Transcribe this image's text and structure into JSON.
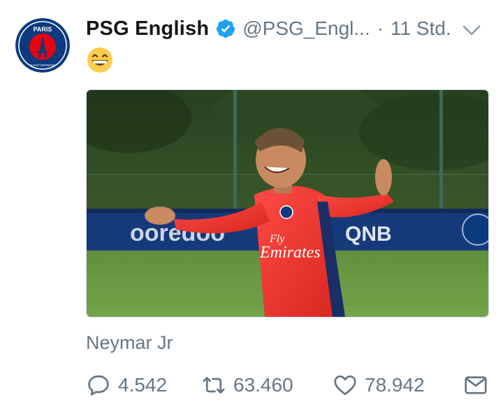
{
  "tweet": {
    "account_name": "PSG English",
    "handle": "@PSG_Engl...",
    "separator": "·",
    "time": "11 Std.",
    "avatar_text_top": "PARIS",
    "avatar_text_bottom": "SAINT-GERMAIN",
    "media_texts": {
      "sponsor_shirt_1": "Fly",
      "sponsor_shirt_2": "Emirates",
      "board_left": "ooredoo",
      "board_right": "QNB"
    },
    "card_title": "Neymar Jr",
    "stats": {
      "replies": "4.542",
      "retweets": "63.460",
      "likes": "78.942"
    }
  },
  "icons": {
    "verified": "verified-badge-icon",
    "menu": "chevron-down-icon",
    "emoji": "grinning-face-emoji",
    "reply": "reply-icon",
    "retweet": "retweet-icon",
    "like": "heart-icon",
    "message": "envelope-icon"
  },
  "colors": {
    "verified_blue": "#1da1f2",
    "secondary_text": "#657786",
    "psg_navy": "#0b3a7e",
    "psg_red": "#e30613"
  }
}
